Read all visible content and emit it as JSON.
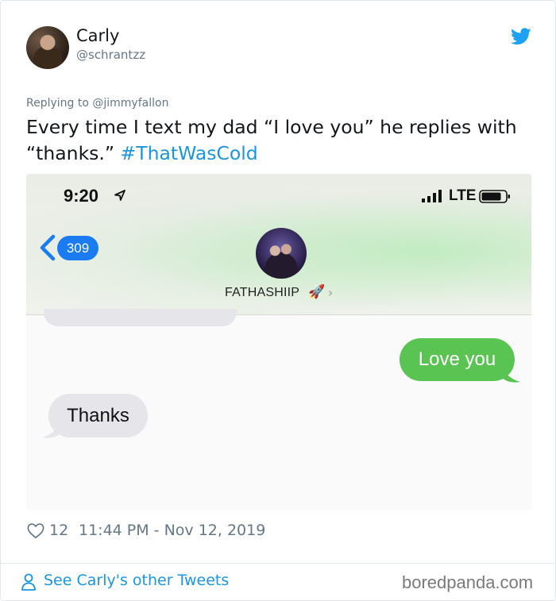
{
  "tweet": {
    "author": {
      "name": "Carly",
      "handle": "@schrantzz"
    },
    "replying_to": "Replying to @jimmyfallon",
    "text": "Every time I text my dad “I love you” he replies with “thanks.” ",
    "hashtag": "#ThatWasCold",
    "likes": "12",
    "timestamp": "11:44 PM - Nov 12, 2019",
    "see_more": "See Carly's other Tweets"
  },
  "screenshot": {
    "time": "9:20",
    "carrier": "LTE",
    "unread_badge": "309",
    "contact_name": "FATHASHIIP",
    "contact_emoji": "🚀",
    "messages": [
      {
        "direction": "outgoing",
        "text": "Love you"
      },
      {
        "direction": "incoming",
        "text": "Thanks"
      }
    ]
  },
  "watermark": "boredpanda.com",
  "colors": {
    "link": "#1b95e0",
    "imessage_blue": "#1a7cf0",
    "sms_green": "#5ac452",
    "bubble_gray": "#e6e6ea"
  },
  "icons": [
    "twitter-bird-icon",
    "location-arrow-icon",
    "signal-bars-icon",
    "battery-icon",
    "back-chevron-icon",
    "heart-icon",
    "person-icon"
  ]
}
